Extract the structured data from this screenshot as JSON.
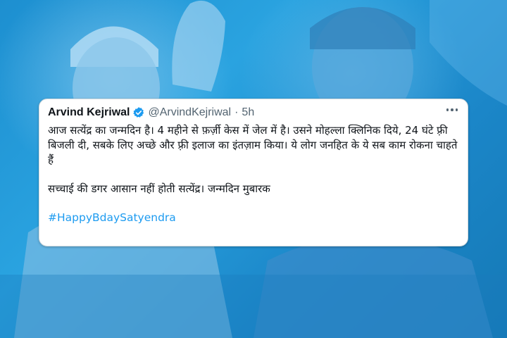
{
  "colors": {
    "background": "#1d8fd0",
    "card": "#ffffff",
    "text_primary": "#0f1419",
    "text_secondary": "#536471",
    "link": "#1d9bf0",
    "verified_badge": "#1d9bf0"
  },
  "tweet": {
    "author_name": "Arvind Kejriwal",
    "handle": "@ArvindKejriwal",
    "separator": "·",
    "time_ago": "5h",
    "verified_icon": "verified-badge-icon",
    "more_icon": "more-options-icon",
    "paragraph_1": "आज सत्येंद्र का जन्मदिन है। 4 महीने से फ़र्ज़ी केस में जेल में है। उसने मोहल्ला क्लिनिक दिये, 24 घंटे फ़्री बिजली दी, सबके लिए अच्छे और फ़्री इलाज का इंतज़ाम किया। ये लोग जनहित के ये सब काम रोकना चाहते हैं",
    "paragraph_2": "सच्चाई की डगर आसान नहीं होती सत्येंद्र। जन्मदिन मुबारक",
    "hashtag": "#HappyBdaySatyendra"
  }
}
